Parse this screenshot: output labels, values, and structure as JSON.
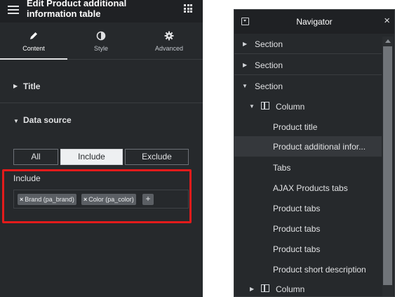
{
  "panel": {
    "title": "Edit Product additional information table",
    "tabs": [
      {
        "label": "Content",
        "icon": "pencil-icon"
      },
      {
        "label": "Style",
        "icon": "half-circle-icon"
      },
      {
        "label": "Advanced",
        "icon": "gear-icon"
      }
    ],
    "sections": [
      {
        "label": "Title",
        "expanded": false
      },
      {
        "label": "Data source",
        "expanded": true
      }
    ],
    "data_source": {
      "options": [
        "All",
        "Include",
        "Exclude"
      ],
      "selected": "Include",
      "include_label": "Include",
      "tags": [
        "Brand (pa_brand)",
        "Color (pa_color)"
      ],
      "add_label": "+"
    },
    "colors": {
      "highlight": "#e31b1b",
      "panel_bg": "#26292c"
    }
  },
  "navigator": {
    "title": "Navigator",
    "close": "×",
    "items": [
      {
        "label": "Section",
        "type": "section",
        "expanded": false
      },
      {
        "label": "Section",
        "type": "section",
        "expanded": false
      },
      {
        "label": "Section",
        "type": "section",
        "expanded": true
      },
      {
        "label": "Column",
        "type": "column",
        "expanded": true
      },
      {
        "label": "Product title",
        "type": "widget"
      },
      {
        "label": "Product additional infor...",
        "type": "widget",
        "active": true
      },
      {
        "label": "Tabs",
        "type": "widget"
      },
      {
        "label": "AJAX Products tabs",
        "type": "widget"
      },
      {
        "label": "Product tabs",
        "type": "widget"
      },
      {
        "label": "Product tabs",
        "type": "widget"
      },
      {
        "label": "Product tabs",
        "type": "widget"
      },
      {
        "label": "Product short description",
        "type": "widget"
      },
      {
        "label": "Column",
        "type": "column",
        "expanded": false
      }
    ]
  }
}
